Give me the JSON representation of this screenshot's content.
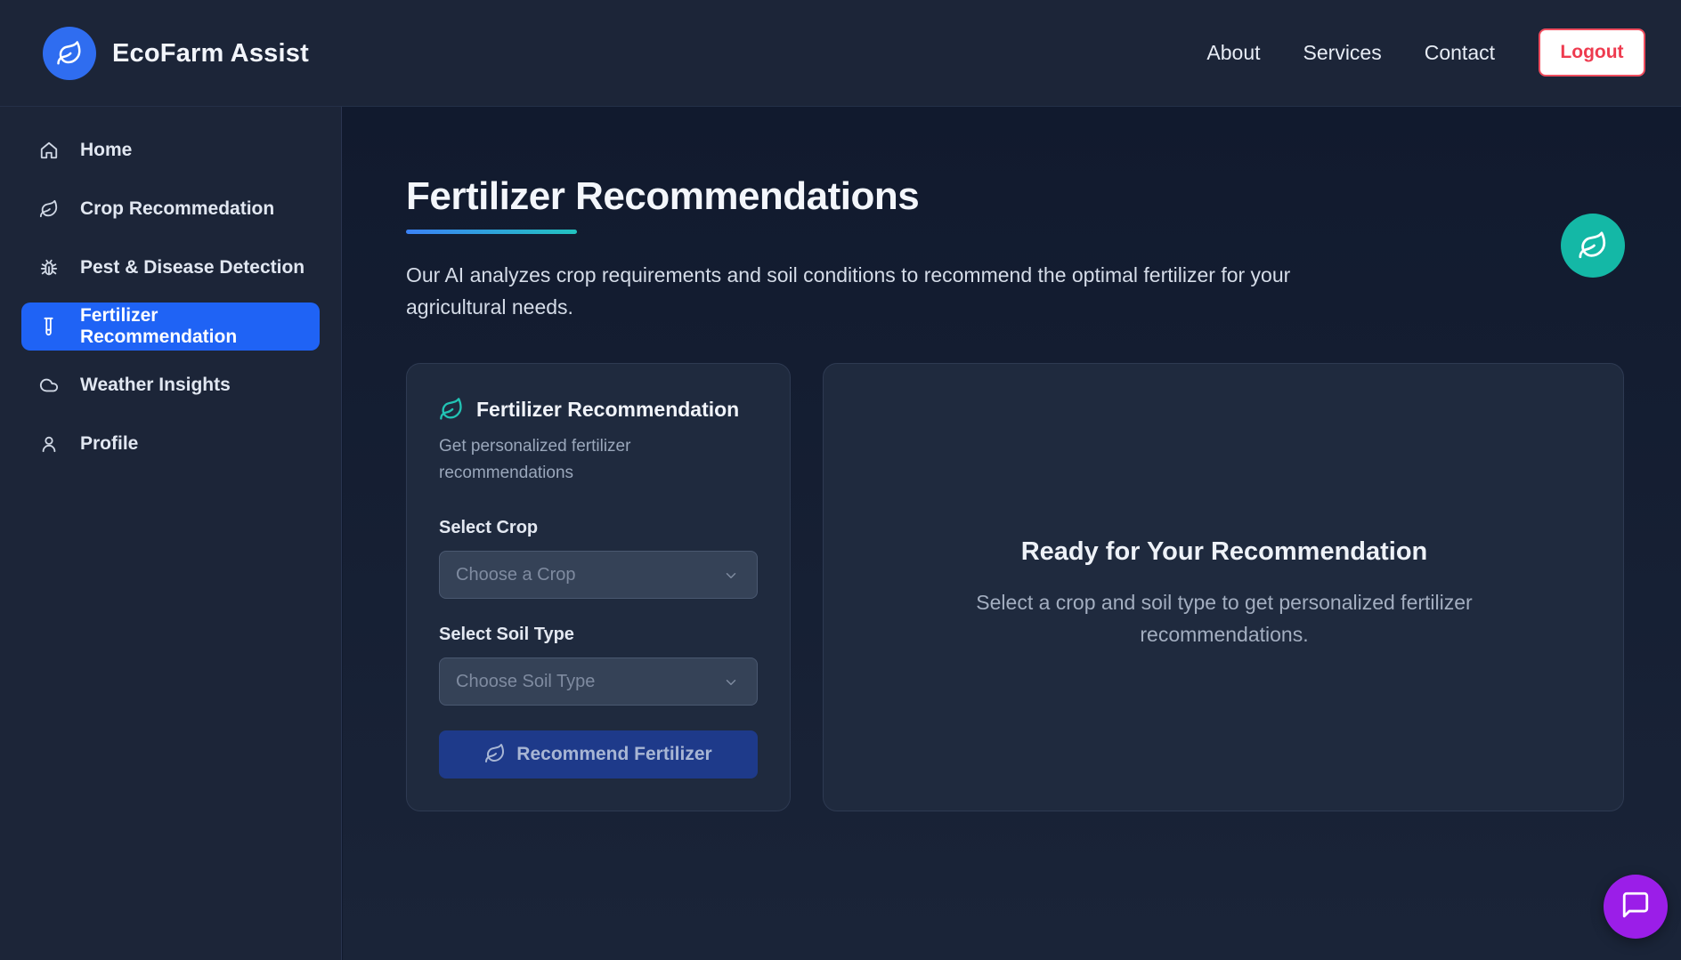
{
  "header": {
    "brand_name": "EcoFarm Assist",
    "nav": [
      "About",
      "Services",
      "Contact"
    ],
    "logout_label": "Logout"
  },
  "sidebar": {
    "items": [
      {
        "label": "Home",
        "icon": "home-icon"
      },
      {
        "label": "Crop Recommedation",
        "icon": "leaf-icon"
      },
      {
        "label": "Pest & Disease Detection",
        "icon": "bug-icon"
      },
      {
        "label": "Fertilizer Recommendation",
        "icon": "test-tube-icon",
        "active": true
      },
      {
        "label": "Weather Insights",
        "icon": "cloud-icon"
      },
      {
        "label": "Profile",
        "icon": "user-icon"
      }
    ]
  },
  "main": {
    "title": "Fertilizer Recommendations",
    "description": "Our AI analyzes crop requirements and soil conditions to recommend the optimal fertilizer for your agricultural needs.",
    "form": {
      "title": "Fertilizer Recommendation",
      "subtitle": "Get personalized fertilizer recommendations",
      "crop_label": "Select Crop",
      "crop_placeholder": "Choose a Crop",
      "soil_label": "Select Soil Type",
      "soil_placeholder": "Choose Soil Type",
      "submit_label": "Recommend Fertilizer"
    },
    "result": {
      "title": "Ready for Your Recommendation",
      "subtitle": "Select a crop and soil type to get personalized fertilizer recommendations."
    }
  },
  "colors": {
    "accent": "#1f63f5",
    "teal": "#14b8a6",
    "logout": "#ee3b4f",
    "chat": "#9b1ee8"
  }
}
